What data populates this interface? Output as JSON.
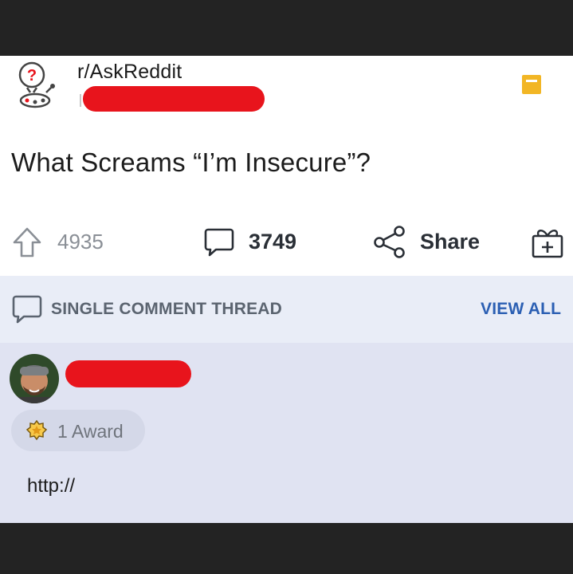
{
  "post": {
    "subreddit": "r/AskReddit",
    "title": "What Screams “I’m Insecure”?",
    "upvotes": "4935",
    "comments": "3749",
    "share_label": "Share"
  },
  "thread": {
    "label": "SINGLE COMMENT THREAD",
    "view_all": "VIEW ALL"
  },
  "comment": {
    "award": "1 Award",
    "body": "http://"
  },
  "icons": {
    "subreddit_avatar": "askreddit-snoo-icon",
    "save": "save-icon",
    "upvote": "upvote-arrow-icon",
    "comment": "comment-bubble-icon",
    "share": "share-icon",
    "gift": "gift-award-icon",
    "award": "award-badge-icon"
  },
  "colors": {
    "redaction": "#e8141c",
    "link": "#2b5fb3",
    "save": "#f2b625"
  }
}
